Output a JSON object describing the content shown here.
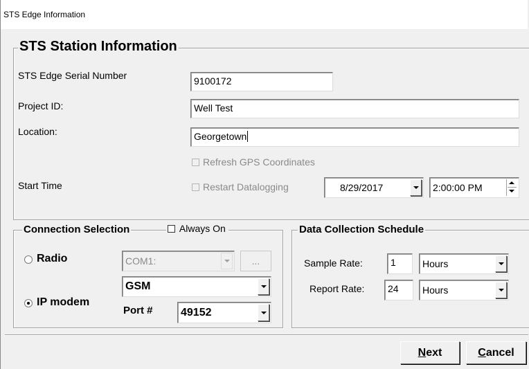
{
  "window": {
    "title": "STS Edge Information"
  },
  "station": {
    "heading": "STS Station Information",
    "serial_label": "STS Edge Serial Number",
    "serial_value": "9100172",
    "project_label": "Project ID:",
    "project_value": "Well Test",
    "location_label": "Location:",
    "location_value": "Georgetown",
    "refresh_gps_label": "Refresh GPS Coordinates",
    "start_time_label": "Start Time",
    "restart_label": "Restart Datalogging",
    "start_date": "8/29/2017",
    "start_clock": "2:00:00 PM"
  },
  "connection": {
    "heading": "Connection Selection",
    "always_on_label": "Always On",
    "radio_label": "Radio",
    "radio_port": "COM1:",
    "browse_label": "...",
    "ipmodem_label": "IP modem",
    "ipmodem_type": "GSM",
    "port_label": "Port #",
    "port_value": "49152"
  },
  "schedule": {
    "heading": "Data Collection Schedule",
    "sample_label": "Sample Rate:",
    "sample_value": "1",
    "sample_unit": "Hours",
    "report_label": "Report Rate:",
    "report_value": "24",
    "report_unit": "Hours"
  },
  "buttons": {
    "next_prefix": "N",
    "next_rest": "ext",
    "cancel_prefix": "C",
    "cancel_rest": "ancel"
  }
}
